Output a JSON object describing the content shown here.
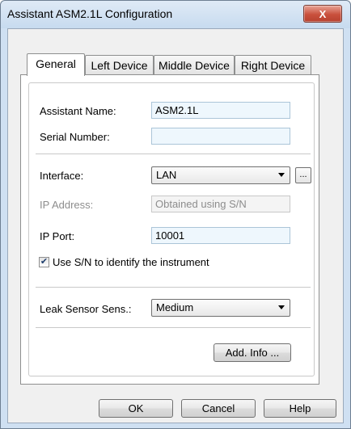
{
  "window": {
    "title": "Assistant ASM2.1L Configuration",
    "close_glyph": "X"
  },
  "tabs": [
    {
      "label": "General",
      "active": true
    },
    {
      "label": "Left Device",
      "active": false
    },
    {
      "label": "Middle Device",
      "active": false
    },
    {
      "label": "Right Device",
      "active": false
    }
  ],
  "general": {
    "assistant_name_label": "Assistant Name:",
    "assistant_name_value": "ASM2.1L",
    "serial_number_label": "Serial Number:",
    "serial_number_value": "",
    "interface_label": "Interface:",
    "interface_value": "LAN",
    "interface_more_label": "...",
    "ip_address_label": "IP Address:",
    "ip_address_value": "Obtained using S/N",
    "ip_port_label": "IP Port:",
    "ip_port_value": "10001",
    "use_sn_label": "Use S/N to identify the instrument",
    "use_sn_checked": true,
    "use_sn_checkmark": "✔",
    "leak_sensor_label": "Leak Sensor Sens.:",
    "leak_sensor_value": "Medium",
    "add_info_label": "Add. Info ..."
  },
  "footer": {
    "ok_label": "OK",
    "cancel_label": "Cancel",
    "help_label": "Help"
  },
  "colors": {
    "close_button": "#c9503d",
    "field_background": "#eef7fd",
    "disabled_text": "#8d8d8d"
  }
}
